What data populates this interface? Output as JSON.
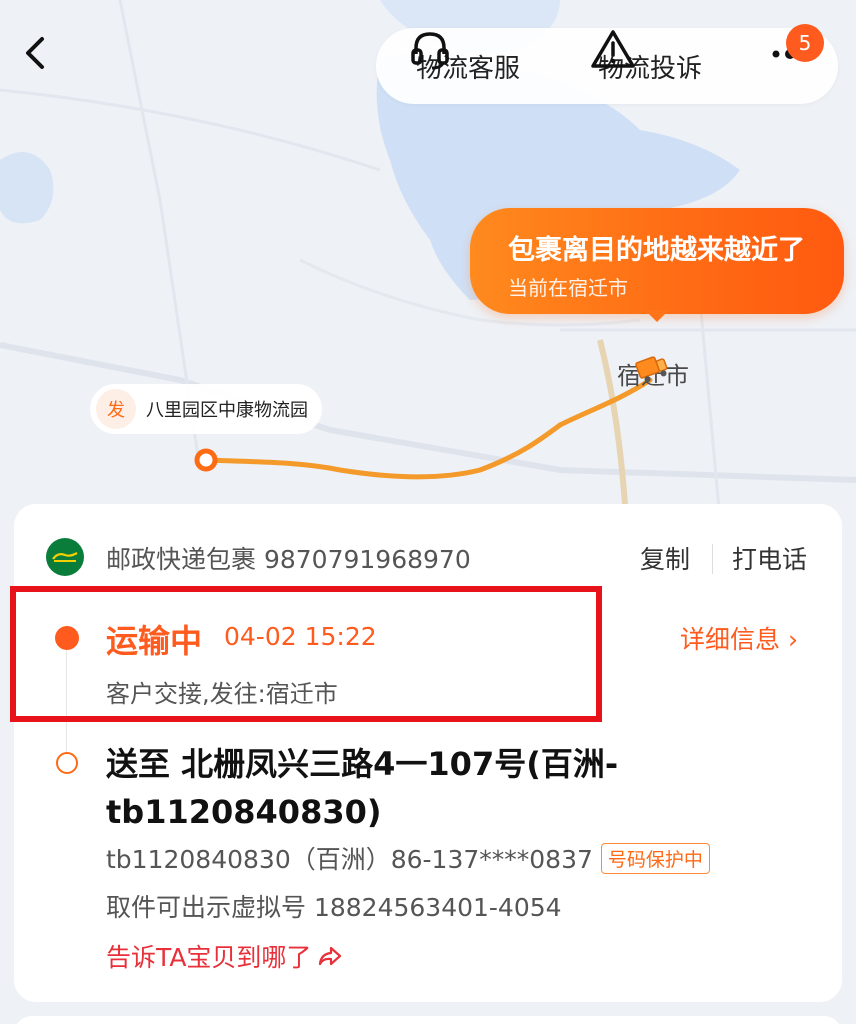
{
  "header": {
    "service_label": "物流客服",
    "complaint_label": "物流投诉",
    "badge_count": "5"
  },
  "map": {
    "bubble_title": "包裹离目的地越来越近了",
    "bubble_sub": "当前在宿迁市",
    "city_label": "宿迁市",
    "origin_tag": "发",
    "origin_name": "八里园区中康物流园",
    "route_color": "#f39a2a"
  },
  "card": {
    "courier": "邮政快递包裹 9870791968970",
    "copy_label": "复制",
    "call_label": "打电话",
    "status": "运输中",
    "status_time": "04-02 15:22",
    "status_desc": "客户交接,发往:宿迁市",
    "detail_label": "详细信息 ›",
    "dest_title": "送至 北栅凤兴三路4一107号(百洲-tb1120840830)",
    "dest_contact": "tb1120840830（百洲）86-137****0837",
    "protect_badge": "号码保护中",
    "virtual_line": "取件可出示虚拟号 18824563401-4054",
    "tell_label": "告诉TA宝贝到哪了"
  },
  "colors": {
    "accent": "#ff5b1f",
    "highlight": "#e8121a"
  }
}
